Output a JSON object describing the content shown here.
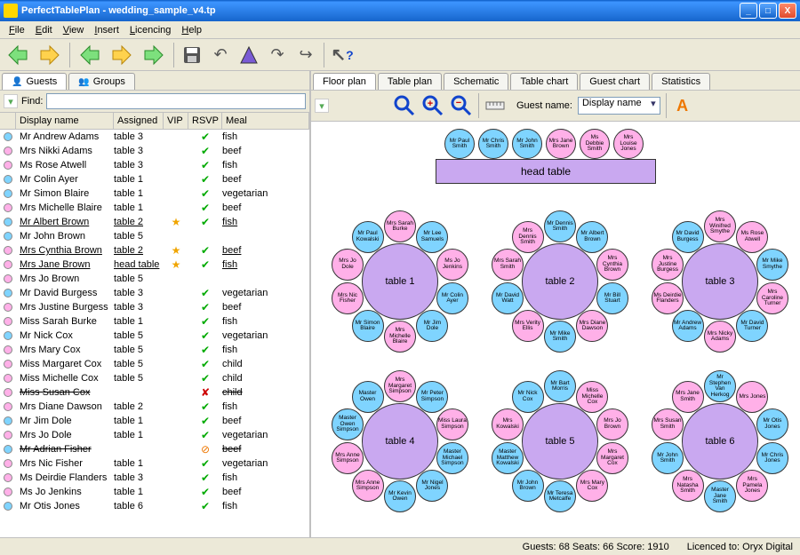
{
  "window": {
    "title": "PerfectTablePlan - wedding_sample_v4.tp"
  },
  "menu": [
    "File",
    "Edit",
    "View",
    "Insert",
    "Licencing",
    "Help"
  ],
  "left_tabs": [
    {
      "label": "Guests",
      "active": true
    },
    {
      "label": "Groups",
      "active": false
    }
  ],
  "find_label": "Find:",
  "guest_columns": {
    "name": "Display name",
    "assigned": "Assigned",
    "vip": "VIP",
    "rsvp": "RSVP",
    "meal": "Meal"
  },
  "guests": [
    {
      "color": "#7fd4ff",
      "name": "Mr Andrew Adams",
      "assigned": "table 3",
      "vip": false,
      "rsvp": "✔",
      "meal": "fish"
    },
    {
      "color": "#ffb0e8",
      "name": "Mrs Nikki Adams",
      "assigned": "table 3",
      "vip": false,
      "rsvp": "✔",
      "meal": "beef"
    },
    {
      "color": "#ffb0e8",
      "name": "Ms Rose Atwell",
      "assigned": "table 3",
      "vip": false,
      "rsvp": "✔",
      "meal": "fish"
    },
    {
      "color": "#7fd4ff",
      "name": "Mr Colin Ayer",
      "assigned": "table 1",
      "vip": false,
      "rsvp": "✔",
      "meal": "beef"
    },
    {
      "color": "#7fd4ff",
      "name": "Mr Simon Blaire",
      "assigned": "table 1",
      "vip": false,
      "rsvp": "✔",
      "meal": "vegetarian"
    },
    {
      "color": "#ffb0e8",
      "name": "Mrs Michelle Blaire",
      "assigned": "table 1",
      "vip": false,
      "rsvp": "✔",
      "meal": "beef"
    },
    {
      "color": "#7fd4ff",
      "name": "Mr Albert Brown",
      "assigned": "table 2",
      "vip": true,
      "rsvp": "✔",
      "meal": "fish",
      "underline": true
    },
    {
      "color": "#7fd4ff",
      "name": "Mr John Brown",
      "assigned": "table 5",
      "vip": false,
      "rsvp": "",
      "meal": ""
    },
    {
      "color": "#ffb0e8",
      "name": "Mrs Cynthia Brown",
      "assigned": "table 2",
      "vip": true,
      "rsvp": "✔",
      "meal": "beef",
      "underline": true
    },
    {
      "color": "#ffb0e8",
      "name": "Mrs Jane Brown",
      "assigned": "head table",
      "vip": true,
      "rsvp": "✔",
      "meal": "fish",
      "underline": true
    },
    {
      "color": "#ffb0e8",
      "name": "Mrs Jo Brown",
      "assigned": "table 5",
      "vip": false,
      "rsvp": "",
      "meal": ""
    },
    {
      "color": "#7fd4ff",
      "name": "Mr David Burgess",
      "assigned": "table 3",
      "vip": false,
      "rsvp": "✔",
      "meal": "vegetarian"
    },
    {
      "color": "#ffb0e8",
      "name": "Mrs Justine Burgess",
      "assigned": "table 3",
      "vip": false,
      "rsvp": "✔",
      "meal": "beef"
    },
    {
      "color": "#ffb0e8",
      "name": "Miss Sarah Burke",
      "assigned": "table 1",
      "vip": false,
      "rsvp": "✔",
      "meal": "fish"
    },
    {
      "color": "#7fd4ff",
      "name": "Mr Nick Cox",
      "assigned": "table 5",
      "vip": false,
      "rsvp": "✔",
      "meal": "vegetarian"
    },
    {
      "color": "#ffb0e8",
      "name": "Mrs Mary Cox",
      "assigned": "table 5",
      "vip": false,
      "rsvp": "✔",
      "meal": "fish"
    },
    {
      "color": "#ffb0e8",
      "name": "Miss Margaret Cox",
      "assigned": "table 5",
      "vip": false,
      "rsvp": "✔",
      "meal": "child"
    },
    {
      "color": "#ffb0e8",
      "name": "Miss Michelle Cox",
      "assigned": "table 5",
      "vip": false,
      "rsvp": "✔",
      "meal": "child"
    },
    {
      "color": "#ffb0e8",
      "name": "Miss Susan Cox",
      "assigned": "",
      "vip": false,
      "rsvp": "✘",
      "meal": "child",
      "strike": true
    },
    {
      "color": "#ffb0e8",
      "name": "Mrs Diane Dawson",
      "assigned": "table 2",
      "vip": false,
      "rsvp": "✔",
      "meal": "fish"
    },
    {
      "color": "#7fd4ff",
      "name": "Mr Jim Dole",
      "assigned": "table 1",
      "vip": false,
      "rsvp": "✔",
      "meal": "beef"
    },
    {
      "color": "#ffb0e8",
      "name": "Mrs Jo Dole",
      "assigned": "table 1",
      "vip": false,
      "rsvp": "✔",
      "meal": "vegetarian"
    },
    {
      "color": "#7fd4ff",
      "name": "Mr Adrian Fisher",
      "assigned": "",
      "vip": false,
      "rsvp": "⊘",
      "meal": "beef",
      "strike": true
    },
    {
      "color": "#ffb0e8",
      "name": "Mrs Nic Fisher",
      "assigned": "table 1",
      "vip": false,
      "rsvp": "✔",
      "meal": "vegetarian"
    },
    {
      "color": "#ffb0e8",
      "name": "Ms Deirdie Flanders",
      "assigned": "table 3",
      "vip": false,
      "rsvp": "✔",
      "meal": "fish"
    },
    {
      "color": "#ffb0e8",
      "name": "Ms Jo Jenkins",
      "assigned": "table 1",
      "vip": false,
      "rsvp": "✔",
      "meal": "beef"
    },
    {
      "color": "#7fd4ff",
      "name": "Mr Otis Jones",
      "assigned": "table 6",
      "vip": false,
      "rsvp": "✔",
      "meal": "fish"
    }
  ],
  "right_tabs": [
    {
      "label": "Floor plan",
      "active": true
    },
    {
      "label": "Table plan"
    },
    {
      "label": "Schematic"
    },
    {
      "label": "Table chart"
    },
    {
      "label": "Guest chart"
    },
    {
      "label": "Statistics"
    }
  ],
  "guest_name_label": "Guest name:",
  "guest_name_value": "Display name",
  "head_table": {
    "label": "head table",
    "seats": [
      {
        "name": "Mr Paul Smith",
        "c": "blue"
      },
      {
        "name": "Mr Chris Smith",
        "c": "blue"
      },
      {
        "name": "Mr John Smith",
        "c": "blue"
      },
      {
        "name": "Mrs Jane Brown",
        "c": "pink"
      },
      {
        "name": "Ms Debbie Smith",
        "c": "pink"
      },
      {
        "name": "Mrs Louise Jones",
        "c": "pink"
      }
    ]
  },
  "tables": [
    {
      "label": "table 1",
      "seats": [
        {
          "name": "Mrs Sarah Burke",
          "c": "pink"
        },
        {
          "name": "Mr Lee Samuels",
          "c": "blue"
        },
        {
          "name": "Ms Jo Jenkins",
          "c": "pink"
        },
        {
          "name": "Mr Colin Ayer",
          "c": "blue"
        },
        {
          "name": "Mr Jim Dole",
          "c": "blue"
        },
        {
          "name": "Mrs Michelle Blaire",
          "c": "pink"
        },
        {
          "name": "Mr Simon Blaire",
          "c": "blue"
        },
        {
          "name": "Mrs Nic Fisher",
          "c": "pink"
        },
        {
          "name": "Mrs Jo Dole",
          "c": "pink"
        },
        {
          "name": "Mr Paul Kowalski",
          "c": "blue"
        }
      ]
    },
    {
      "label": "table 2",
      "seats": [
        {
          "name": "Mr Dennis Smith",
          "c": "blue"
        },
        {
          "name": "Mr Albert Brown",
          "c": "blue"
        },
        {
          "name": "Mrs Cynthia Brown",
          "c": "pink"
        },
        {
          "name": "Mr Bill Stuart",
          "c": "blue"
        },
        {
          "name": "Mrs Diane Dawson",
          "c": "pink"
        },
        {
          "name": "Mr Mike Smith",
          "c": "blue"
        },
        {
          "name": "Mrs Verity Ellis",
          "c": "pink"
        },
        {
          "name": "Mr David Watt",
          "c": "blue"
        },
        {
          "name": "Mrs Sarah Smith",
          "c": "pink"
        },
        {
          "name": "Mrs Dennis Smith",
          "c": "pink"
        }
      ]
    },
    {
      "label": "table 3",
      "seats": [
        {
          "name": "Mrs Winifred Smythe",
          "c": "pink"
        },
        {
          "name": "Ms Rose Atwell",
          "c": "pink"
        },
        {
          "name": "Mr Mike Smythe",
          "c": "blue"
        },
        {
          "name": "Mrs Caroline Turner",
          "c": "pink"
        },
        {
          "name": "Mr David Turner",
          "c": "blue"
        },
        {
          "name": "Mrs Nicky Adams",
          "c": "pink"
        },
        {
          "name": "Mr Andrew Adams",
          "c": "blue"
        },
        {
          "name": "Ms Deirdie Flanders",
          "c": "pink"
        },
        {
          "name": "Mrs Justine Burgess",
          "c": "pink"
        },
        {
          "name": "Mr David Burgess",
          "c": "blue"
        }
      ]
    },
    {
      "label": "table 4",
      "seats": [
        {
          "name": "Mrs Margaret Simpson",
          "c": "pink"
        },
        {
          "name": "Mr Peter Simpson",
          "c": "blue"
        },
        {
          "name": "Miss Laura Simpson",
          "c": "pink"
        },
        {
          "name": "Master Michael Simpson",
          "c": "blue"
        },
        {
          "name": "Mr Nigel Jones",
          "c": "blue"
        },
        {
          "name": "Mr Kevin Owen",
          "c": "blue"
        },
        {
          "name": "Mrs Anne Simpson",
          "c": "pink"
        },
        {
          "name": "Mrs Anne Simpson",
          "c": "pink"
        },
        {
          "name": "Master Owen Simpson",
          "c": "blue"
        },
        {
          "name": "Master Owen",
          "c": "blue"
        }
      ]
    },
    {
      "label": "table 5",
      "seats": [
        {
          "name": "Mr Bart Morris",
          "c": "blue"
        },
        {
          "name": "Miss Michelle Cox",
          "c": "pink"
        },
        {
          "name": "Mrs Jo Brown",
          "c": "pink"
        },
        {
          "name": "Mrs Margaret Cox",
          "c": "pink"
        },
        {
          "name": "Mrs Mary Cox",
          "c": "pink"
        },
        {
          "name": "Mr Teresa Metcalfe",
          "c": "blue"
        },
        {
          "name": "Mr John Brown",
          "c": "blue"
        },
        {
          "name": "Master Matthew Kowalski",
          "c": "blue"
        },
        {
          "name": "Mrs Kowalski",
          "c": "pink"
        },
        {
          "name": "Mr Nick Cox",
          "c": "blue"
        }
      ]
    },
    {
      "label": "table 6",
      "seats": [
        {
          "name": "Mr Stephen Van Herkog",
          "c": "blue"
        },
        {
          "name": "Mrs Jones",
          "c": "pink"
        },
        {
          "name": "Mr Otis Jones",
          "c": "blue"
        },
        {
          "name": "Mr Chris Jones",
          "c": "blue"
        },
        {
          "name": "Mrs Pamela Jones",
          "c": "pink"
        },
        {
          "name": "Master Jane Smith",
          "c": "blue"
        },
        {
          "name": "Mrs Natasha Smith",
          "c": "pink"
        },
        {
          "name": "Mr John Smith",
          "c": "blue"
        },
        {
          "name": "Mrs Susan Smith",
          "c": "pink"
        },
        {
          "name": "Mrs Jane Smith",
          "c": "pink"
        }
      ]
    }
  ],
  "status": {
    "summary": "Guests: 68 Seats: 66 Score: 1910",
    "licence": "Licenced to: Oryx Digital"
  }
}
